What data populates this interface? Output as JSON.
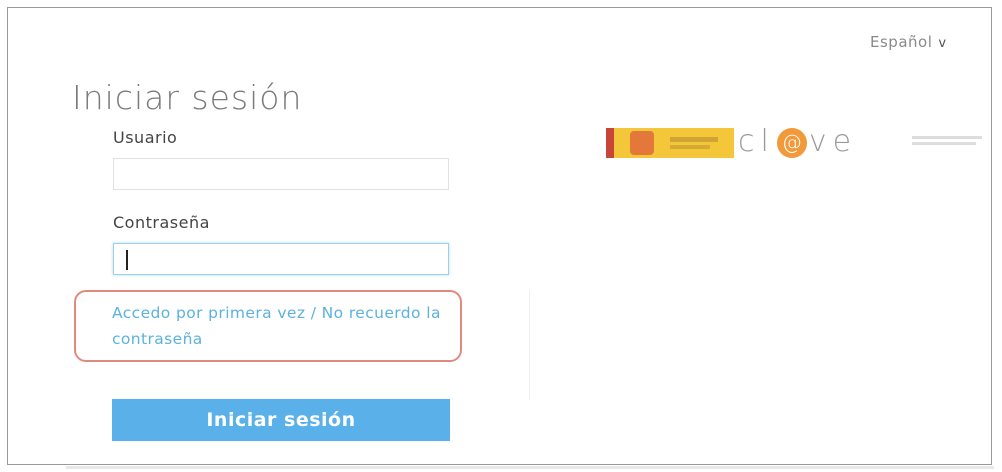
{
  "language": {
    "label": "Español",
    "chevron": "v"
  },
  "login": {
    "title": "Iniciar sesión",
    "username_label": "Usuario",
    "username_value": "",
    "password_label": "Contraseña",
    "password_value": "",
    "forgot_link": "Accedo por primera vez / No recuerdo la contraseña",
    "submit_label": "Iniciar sesión"
  },
  "brand": {
    "logo_text_prefix": "cl",
    "logo_at": "@",
    "logo_text_suffix": "ve",
    "shield_color": "#f4c63a",
    "accent_color": "#f2993a"
  },
  "colors": {
    "link": "#5bb2de",
    "button": "#5ab0e9",
    "highlight_box": "#e08a7e"
  }
}
